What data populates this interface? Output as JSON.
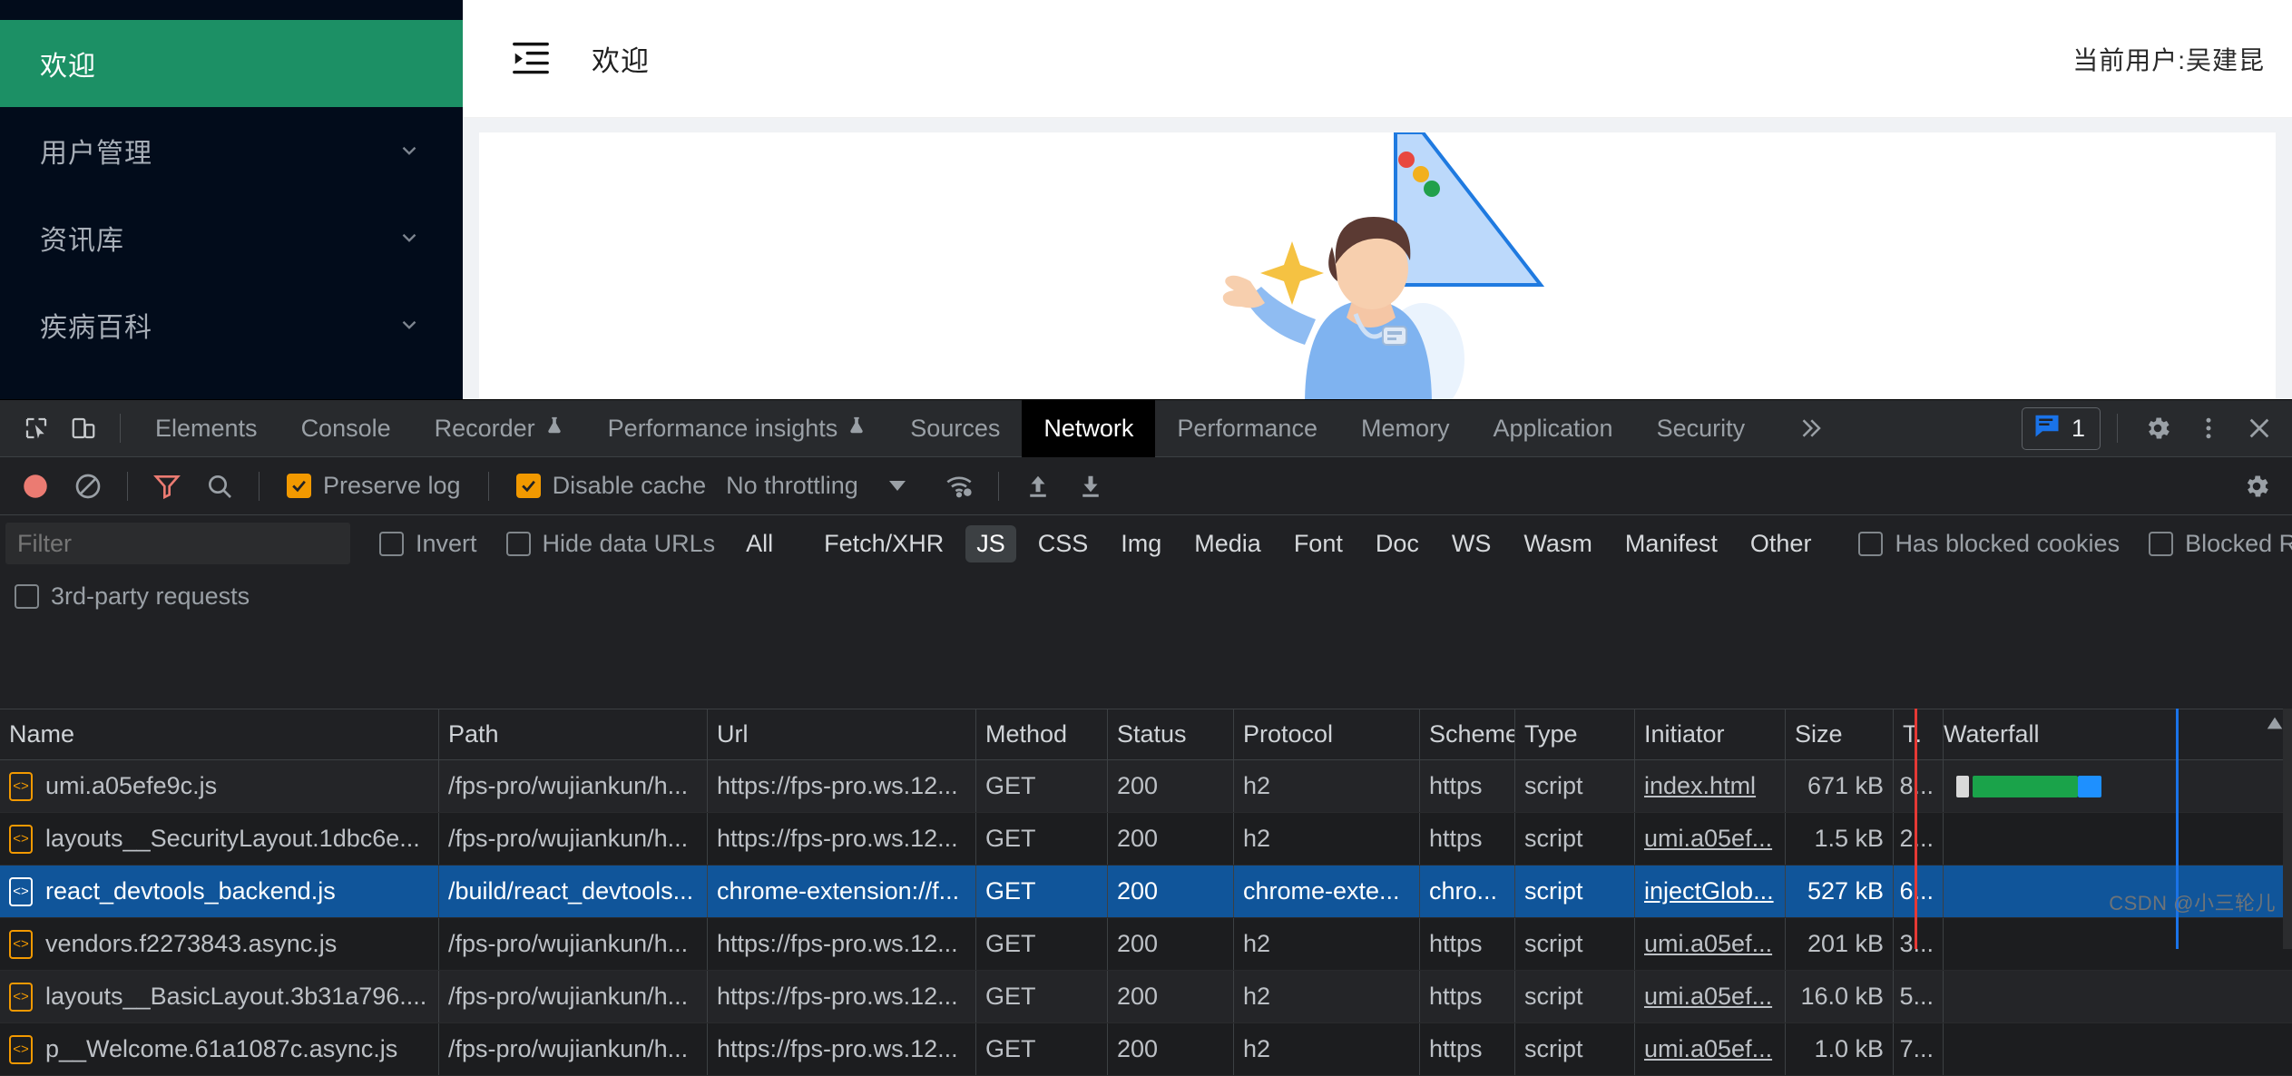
{
  "app": {
    "sidebar": {
      "items": [
        {
          "label": "欢迎",
          "active": true,
          "expandable": false
        },
        {
          "label": "用户管理",
          "active": false,
          "expandable": true
        },
        {
          "label": "资讯库",
          "active": false,
          "expandable": true
        },
        {
          "label": "疾病百科",
          "active": false,
          "expandable": true
        }
      ],
      "bg_color": "#020c1b",
      "active_color": "#1c9065"
    },
    "header": {
      "collapse_icon": "menu-fold-icon",
      "title": "欢迎",
      "user_label": "当前用户:吴建昆"
    }
  },
  "devtools": {
    "tabbar": {
      "inspect_icon": "inspect-element-icon",
      "device_icon": "device-toolbar-icon",
      "tabs": [
        {
          "label": "Elements",
          "active": false,
          "experimental": false
        },
        {
          "label": "Console",
          "active": false,
          "experimental": false
        },
        {
          "label": "Recorder",
          "active": false,
          "experimental": true
        },
        {
          "label": "Performance insights",
          "active": false,
          "experimental": true
        },
        {
          "label": "Sources",
          "active": false,
          "experimental": false
        },
        {
          "label": "Network",
          "active": true,
          "experimental": false
        },
        {
          "label": "Performance",
          "active": false,
          "experimental": false
        },
        {
          "label": "Memory",
          "active": false,
          "experimental": false
        },
        {
          "label": "Application",
          "active": false,
          "experimental": false
        },
        {
          "label": "Security",
          "active": false,
          "experimental": false
        }
      ],
      "more_tabs_icon": "chevron-double-right-icon",
      "issues_count": "1",
      "issues_icon": "issues-message-icon",
      "settings_icon": "gear-icon",
      "more_icon": "three-dots-vertical-icon",
      "close_icon": "close-icon"
    },
    "toolbar": {
      "record_icon": "record-stop-icon",
      "clear_icon": "clear-network-log-icon",
      "filter_icon": "filter-funnel-icon",
      "search_icon": "search-icon",
      "preserve_log_label": "Preserve log",
      "preserve_log_checked": true,
      "disable_cache_label": "Disable cache",
      "disable_cache_checked": true,
      "throttling_value": "No throttling",
      "throttling_caret": "chevron-down-icon",
      "network_conditions_icon": "wifi-settings-icon",
      "import_har_icon": "upload-arrow-icon",
      "export_har_icon": "download-arrow-icon",
      "more_settings_icon": "settings-gear-icon"
    },
    "filterbar": {
      "filter_placeholder": "Filter",
      "filter_value": "",
      "invert_label": "Invert",
      "invert_checked": false,
      "hide_data_urls_label": "Hide data URLs",
      "hide_data_urls_checked": false,
      "types": [
        {
          "label": "All",
          "active": false
        },
        {
          "label": "Fetch/XHR",
          "active": false
        },
        {
          "label": "JS",
          "active": true
        },
        {
          "label": "CSS",
          "active": false
        },
        {
          "label": "Img",
          "active": false
        },
        {
          "label": "Media",
          "active": false
        },
        {
          "label": "Font",
          "active": false
        },
        {
          "label": "Doc",
          "active": false
        },
        {
          "label": "WS",
          "active": false
        },
        {
          "label": "Wasm",
          "active": false
        },
        {
          "label": "Manifest",
          "active": false
        },
        {
          "label": "Other",
          "active": false
        }
      ],
      "has_blocked_cookies_label": "Has blocked cookies",
      "has_blocked_cookies_checked": false,
      "blocked_requests_label": "Blocked Requests",
      "blocked_requests_checked": false,
      "third_party_label": "3rd-party requests",
      "third_party_checked": false
    },
    "table": {
      "columns": [
        {
          "key": "name",
          "label": "Name"
        },
        {
          "key": "path",
          "label": "Path"
        },
        {
          "key": "url",
          "label": "Url"
        },
        {
          "key": "method",
          "label": "Method"
        },
        {
          "key": "status",
          "label": "Status"
        },
        {
          "key": "protocol",
          "label": "Protocol"
        },
        {
          "key": "scheme",
          "label": "Scheme"
        },
        {
          "key": "type",
          "label": "Type"
        },
        {
          "key": "initiator",
          "label": "Initiator"
        },
        {
          "key": "size",
          "label": "Size"
        },
        {
          "key": "time",
          "label": "T."
        },
        {
          "key": "waterfall",
          "label": "Waterfall"
        }
      ],
      "rows": [
        {
          "name": "umi.a05efe9c.js",
          "path": "/fps-pro/wujiankun/h...",
          "url": "https://fps-pro.ws.12...",
          "method": "GET",
          "status": "200",
          "protocol": "h2",
          "scheme": "https",
          "type": "script",
          "initiator": "index.html",
          "size": "671 kB",
          "time": "8...",
          "selected": false
        },
        {
          "name": "layouts__SecurityLayout.1dbc6e...",
          "path": "/fps-pro/wujiankun/h...",
          "url": "https://fps-pro.ws.12...",
          "method": "GET",
          "status": "200",
          "protocol": "h2",
          "scheme": "https",
          "type": "script",
          "initiator": "umi.a05ef...",
          "size": "1.5 kB",
          "time": "2...",
          "selected": false
        },
        {
          "name": "react_devtools_backend.js",
          "path": "/build/react_devtools...",
          "url": "chrome-extension://f...",
          "method": "GET",
          "status": "200",
          "protocol": "chrome-exte...",
          "scheme": "chro...",
          "type": "script",
          "initiator": "injectGlob...",
          "size": "527 kB",
          "time": "6...",
          "selected": true
        },
        {
          "name": "vendors.f2273843.async.js",
          "path": "/fps-pro/wujiankun/h...",
          "url": "https://fps-pro.ws.12...",
          "method": "GET",
          "status": "200",
          "protocol": "h2",
          "scheme": "https",
          "type": "script",
          "initiator": "umi.a05ef...",
          "size": "201 kB",
          "time": "3...",
          "selected": false
        },
        {
          "name": "layouts__BasicLayout.3b31a796....",
          "path": "/fps-pro/wujiankun/h...",
          "url": "https://fps-pro.ws.12...",
          "method": "GET",
          "status": "200",
          "protocol": "h2",
          "scheme": "https",
          "type": "script",
          "initiator": "umi.a05ef...",
          "size": "16.0 kB",
          "time": "5...",
          "selected": false
        },
        {
          "name": "p__Welcome.61a1087c.async.js",
          "path": "/fps-pro/wujiankun/h...",
          "url": "https://fps-pro.ws.12...",
          "method": "GET",
          "status": "200",
          "protocol": "h2",
          "scheme": "https",
          "type": "script",
          "initiator": "umi.a05ef...",
          "size": "1.0 kB",
          "time": "7...",
          "selected": false
        }
      ]
    },
    "watermark": "CSDN @小三轮儿"
  }
}
